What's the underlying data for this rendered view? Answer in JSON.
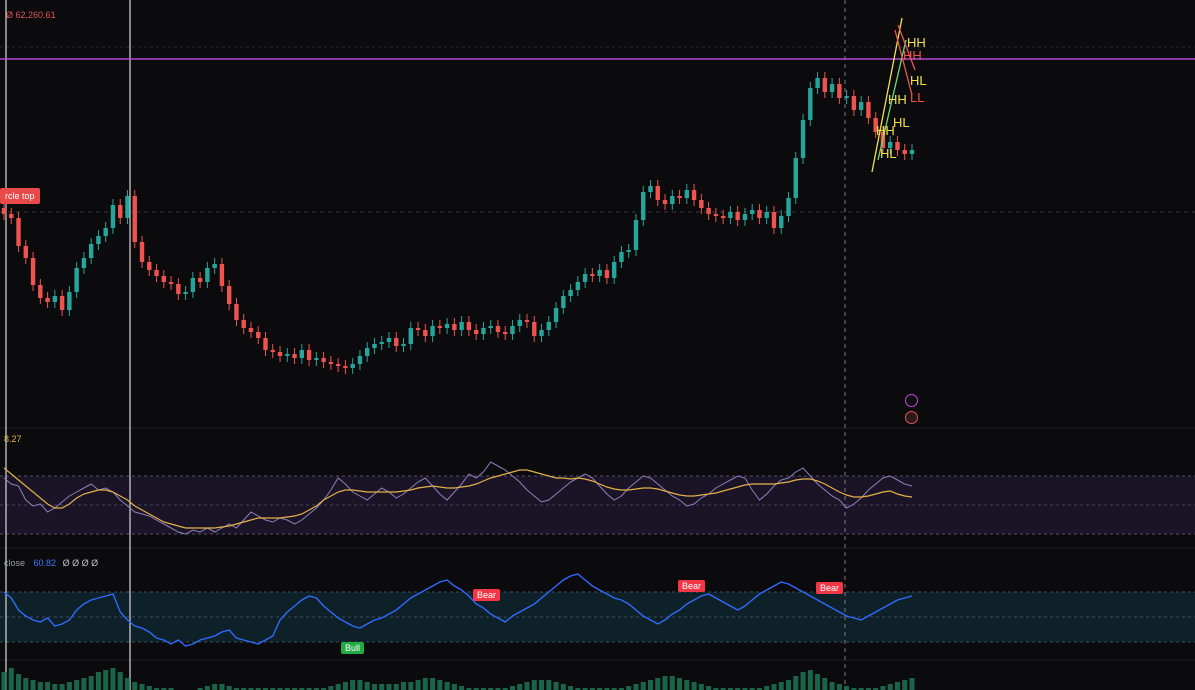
{
  "header": {
    "price_text": "62,260.61",
    "price_prefix": "Ø"
  },
  "labels": {
    "circle_top": "rcle top",
    "rsi_value": "8.27",
    "rsi_close_label": "close",
    "rsi_close_value": "60.82",
    "rsi_close_extra": "Ø Ø Ø Ø",
    "bear": "Bear",
    "bull": "Bull",
    "hh": "HH",
    "hl": "HL",
    "lh": "LH",
    "ll": "LL"
  },
  "colors": {
    "background": "#0b0b0d",
    "bull_candle": "#26a69a",
    "bear_candle": "#ef5350",
    "resistance_line": "#b04bd6",
    "rsi_line": "#8f7fb8",
    "rsi_ma": "#e2b04a",
    "osc_line": "#2f6bff",
    "bear_label": "#f23645",
    "bull_label": "#22ab45",
    "structure_label": "#f2e14b"
  },
  "chart_data": {
    "type": "candlestick",
    "resistance_level_px_free": true,
    "closes": [
      214,
      218,
      246,
      258,
      285,
      298,
      302,
      296,
      310,
      292,
      268,
      258,
      244,
      236,
      228,
      205,
      218,
      196,
      242,
      262,
      270,
      276,
      282,
      284,
      294,
      292,
      278,
      282,
      268,
      264,
      286,
      304,
      320,
      328,
      332,
      338,
      350,
      352,
      356,
      354,
      358,
      350,
      360,
      358,
      362,
      364,
      366,
      368,
      364,
      356,
      348,
      344,
      342,
      338,
      346,
      344,
      328,
      330,
      336,
      326,
      328,
      324,
      330,
      322,
      330,
      334,
      328,
      326,
      332,
      334,
      326,
      320,
      322,
      336,
      330,
      322,
      308,
      296,
      290,
      282,
      274,
      276,
      270,
      278,
      262,
      252,
      250,
      220,
      192,
      186,
      200,
      204,
      196,
      198,
      190,
      200,
      208,
      214,
      216,
      218,
      212,
      220,
      214,
      210,
      218,
      212,
      228,
      216,
      198,
      158,
      120,
      88,
      78,
      92,
      84,
      98,
      96,
      110,
      102,
      118,
      132,
      148,
      142,
      150,
      154,
      150
    ],
    "rsi_main": [
      478,
      484,
      486,
      500,
      506,
      504,
      512,
      508,
      502,
      496,
      492,
      488,
      484,
      490,
      488,
      492,
      500,
      506,
      512,
      514,
      516,
      520,
      524,
      528,
      532,
      534,
      530,
      532,
      528,
      532,
      528,
      524,
      528,
      520,
      512,
      516,
      520,
      522,
      518,
      520,
      524,
      520,
      514,
      508,
      500,
      490,
      478,
      484,
      492,
      496,
      500,
      494,
      488,
      492,
      498,
      494,
      488,
      482,
      478,
      486,
      494,
      500,
      492,
      484,
      474,
      478,
      472,
      462,
      466,
      470,
      476,
      482,
      490,
      496,
      502,
      500,
      494,
      488,
      482,
      478,
      474,
      478,
      486,
      494,
      500,
      496,
      488,
      482,
      476,
      478,
      484,
      490,
      496,
      500,
      506,
      504,
      498,
      494,
      488,
      484,
      480,
      476,
      478,
      490,
      500,
      494,
      486,
      480,
      478,
      472,
      468,
      476,
      484,
      490,
      496,
      500,
      508,
      504,
      498,
      490,
      484,
      478,
      476,
      480,
      484,
      486
    ],
    "rsi_ma": [
      468,
      474,
      480,
      486,
      492,
      498,
      504,
      508,
      508,
      504,
      498,
      494,
      492,
      490,
      490,
      492,
      496,
      500,
      506,
      510,
      514,
      518,
      522,
      524,
      526,
      528,
      528,
      528,
      528,
      528,
      527,
      526,
      524,
      522,
      520,
      518,
      518,
      518,
      518,
      517,
      516,
      514,
      510,
      506,
      500,
      496,
      492,
      490,
      490,
      491,
      492,
      492,
      492,
      492,
      492,
      491,
      490,
      488,
      487,
      486,
      487,
      488,
      488,
      487,
      486,
      484,
      481,
      478,
      476,
      474,
      472,
      470,
      470,
      472,
      474,
      476,
      478,
      478,
      479,
      478,
      479,
      481,
      484,
      487,
      489,
      490,
      490,
      489,
      488,
      488,
      489,
      491,
      493,
      495,
      496,
      496,
      495,
      494,
      493,
      491,
      489,
      487,
      485,
      484,
      484,
      484,
      484,
      483,
      482,
      480,
      479,
      479,
      481,
      484,
      488,
      492,
      495,
      497,
      497,
      496,
      494,
      492,
      491,
      494,
      496,
      497
    ],
    "osc_main": [
      592,
      598,
      610,
      616,
      620,
      622,
      618,
      626,
      624,
      620,
      610,
      604,
      600,
      598,
      596,
      594,
      612,
      620,
      626,
      628,
      632,
      638,
      640,
      644,
      640,
      646,
      644,
      640,
      638,
      636,
      632,
      630,
      638,
      640,
      642,
      644,
      640,
      636,
      620,
      612,
      606,
      600,
      596,
      598,
      606,
      612,
      618,
      622,
      626,
      628,
      624,
      620,
      618,
      614,
      610,
      604,
      598,
      594,
      590,
      586,
      582,
      580,
      586,
      590,
      596,
      604,
      608,
      614,
      618,
      622,
      616,
      612,
      608,
      604,
      598,
      592,
      586,
      580,
      576,
      574,
      580,
      586,
      590,
      594,
      598,
      600,
      604,
      610,
      616,
      620,
      624,
      620,
      614,
      610,
      604,
      600,
      596,
      594,
      598,
      602,
      606,
      610,
      606,
      600,
      594,
      590,
      586,
      582,
      584,
      588,
      592,
      596,
      600,
      604,
      608,
      612,
      616,
      618,
      620,
      616,
      612,
      608,
      604,
      600,
      598,
      596
    ],
    "volume": [
      672,
      668,
      674,
      678,
      680,
      682,
      682,
      684,
      684,
      682,
      680,
      678,
      676,
      672,
      670,
      668,
      672,
      678,
      682,
      684,
      686,
      688,
      688,
      688,
      690,
      690,
      690,
      688,
      686,
      684,
      684,
      686,
      688,
      688,
      688,
      688,
      688,
      688,
      688,
      688,
      688,
      688,
      688,
      688,
      688,
      686,
      684,
      682,
      680,
      680,
      682,
      684,
      684,
      684,
      684,
      682,
      682,
      680,
      678,
      678,
      680,
      682,
      684,
      686,
      688,
      688,
      688,
      688,
      688,
      688,
      686,
      684,
      682,
      680,
      680,
      680,
      682,
      684,
      686,
      688,
      688,
      688,
      688,
      688,
      688,
      688,
      686,
      684,
      682,
      680,
      678,
      676,
      676,
      678,
      680,
      682,
      684,
      686,
      688,
      688,
      688,
      688,
      688,
      688,
      688,
      686,
      684,
      682,
      680,
      676,
      672,
      670,
      674,
      678,
      682,
      684,
      686,
      688,
      688,
      688,
      688,
      686,
      684,
      682,
      680,
      678
    ]
  }
}
